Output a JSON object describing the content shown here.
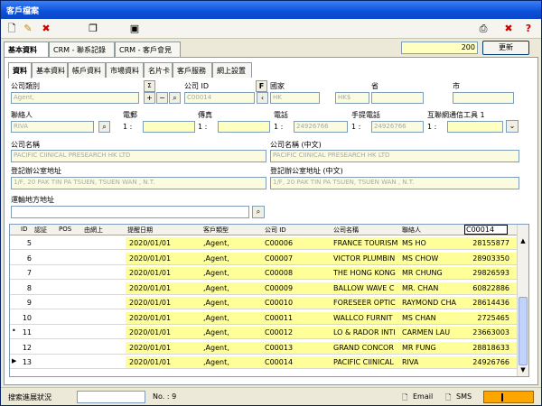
{
  "window": {
    "title": "客戶檔案"
  },
  "top_tabs": [
    {
      "label": "基本資料"
    },
    {
      "label": "CRM - 聯系記錄"
    },
    {
      "label": "CRM - 客戶會見"
    }
  ],
  "counter": "200",
  "update_label": "更新",
  "sub_tabs": [
    {
      "label": "資料"
    },
    {
      "label": "基本資料"
    },
    {
      "label": "帳戶資料"
    },
    {
      "label": "市場資料"
    },
    {
      "label": "名片卡"
    },
    {
      "label": "客戶服務"
    },
    {
      "label": "網上設置"
    }
  ],
  "form": {
    "company_type_label": "公司類別",
    "company_type_value": "Agent,",
    "company_id_label": "公司 ID",
    "company_id_value": "C00014",
    "f_label": "F",
    "sigma_label": "Σ",
    "country_label": "國家",
    "country_value": "HK",
    "currency_value": "HK$",
    "province_label": "省",
    "city_label": "市",
    "contact_label": "聯絡人",
    "contact_value": "RIVA",
    "email_label": "電郵",
    "fax_label": "傳真",
    "phone_label": "電話",
    "phone_value": "24926766",
    "mobile_label": "手提電話",
    "mobile_value": "24926766",
    "im_label": "互聯網通信工具 1",
    "one_label": "1 :",
    "company_name_label": "公司名稱",
    "company_name_value": "PACIFIC CIINICAL PRESEARCH HK LTD",
    "company_name_cn_label": "公司名稱 (中文)",
    "company_name_cn_value": "PACIFIC CIINICAL PRESEARCH HK LTD",
    "reg_addr_label": "登記辦公室地址",
    "reg_addr_value": "1/F, 20 PAK TIN PA TSUEN, TSUEN WAN , N.T.",
    "reg_addr_cn_label": "登記辦公室地址 (中文)",
    "reg_addr_cn_value": "1/F, 20 PAK TIN PA TSUEN, TSUEN WAN , N.T.",
    "ship_addr_label": "運輸地方地址"
  },
  "grid": {
    "headers": [
      "ID",
      "認証",
      "POS",
      "由網上",
      "提醒日期",
      "客戶類型",
      "公司 ID",
      "公司名稱",
      "聯絡人",
      "C00014"
    ],
    "rows": [
      {
        "id": "5",
        "date": "2020/01/01",
        "type": ",Agent,",
        "cid": "C00006",
        "name": "FRANCE TOURISM",
        "contact": "MS HO",
        "phone": "28155877"
      },
      {
        "id": "6",
        "date": "2020/01/01",
        "type": ",Agent,",
        "cid": "C00007",
        "name": "VICTOR PLUMBIN",
        "contact": "MS CHOW",
        "phone": "28903350"
      },
      {
        "id": "7",
        "date": "2020/01/01",
        "type": ",Agent,",
        "cid": "C00008",
        "name": "THE HONG KONG",
        "contact": "MR CHUNG",
        "phone": "29826593"
      },
      {
        "id": "8",
        "date": "2020/01/01",
        "type": ",Agent,",
        "cid": "C00009",
        "name": "BALLOW WAVE C",
        "contact": "MR. CHAN",
        "phone": "60822886"
      },
      {
        "id": "9",
        "date": "2020/01/01",
        "type": ",Agent,",
        "cid": "C00010",
        "name": "FORESEER OPTIC",
        "contact": "RAYMOND CHA",
        "phone": "28614436"
      },
      {
        "id": "10",
        "date": "2020/01/01",
        "type": ",Agent,",
        "cid": "C00011",
        "name": "WALLCO FURNIT",
        "contact": "MS CHAN",
        "phone": "2725465"
      },
      {
        "id": "11",
        "date": "2020/01/01",
        "type": ",Agent,",
        "cid": "C00012",
        "name": "LO & RADOR INTI",
        "contact": "CARMEN LAU",
        "phone": "23663003"
      },
      {
        "id": "12",
        "date": "2020/01/01",
        "type": ",Agent,",
        "cid": "C00013",
        "name": "GRAND CONCOR",
        "contact": "MR FUNG",
        "phone": "28818633"
      },
      {
        "id": "13",
        "date": "2020/01/01",
        "type": ",Agent,",
        "cid": "C00014",
        "name": "PACIFIC CIINICAL",
        "contact": "RIVA",
        "phone": "24926766"
      }
    ]
  },
  "status": {
    "progress_label": "搜索進展狀況",
    "no_label": "No. : 9",
    "email_label": "Email",
    "sms_label": "SMS"
  }
}
